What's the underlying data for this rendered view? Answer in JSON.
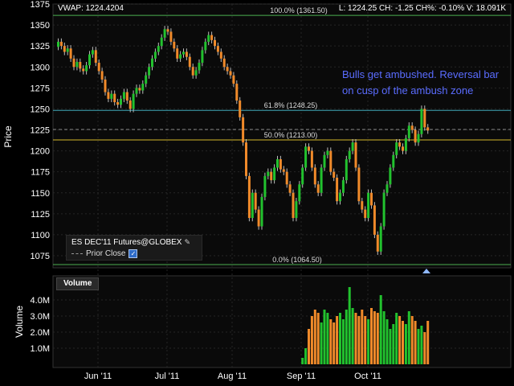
{
  "header": {
    "vwap": "VWAP: 1224.4204",
    "quote": "L: 1224.25  CH: -1.25  CH%: -0.10%  V: 18.091K"
  },
  "annotation": {
    "line1": "Bulls get ambushed. Reversal bar",
    "line2": "on cusp of the ambush zone",
    "color": "#5a6cff"
  },
  "legend": {
    "title": "ES DEC'11 Futures@GLOBEX",
    "prior_close": "Prior Close"
  },
  "volume_tab": "Volume",
  "colors": {
    "up": "#22c22e",
    "down": "#f08a2a",
    "fib_green": "#4caf50",
    "fib_teal": "#3fa8b8",
    "fib_yellow": "#d4b82a",
    "axis_text": "#ffffff",
    "grid": "#262626"
  },
  "chart_data": [
    {
      "type": "candlestick",
      "title": "ES DEC'11 Futures@GLOBEX",
      "ylabel": "Price",
      "ylim": [
        1062,
        1375
      ],
      "y_ticks": [
        1075,
        1100,
        1125,
        1150,
        1175,
        1200,
        1225,
        1250,
        1275,
        1300,
        1325,
        1350,
        1375
      ],
      "x_ticks": [
        "Jun '11",
        "Jul '11",
        "Aug '11",
        "Sep '11",
        "Oct '11"
      ],
      "fib_levels": [
        {
          "label": "100.0% (1361.50)",
          "value": 1361.5,
          "color": "#4caf50"
        },
        {
          "label": "61.8% (1248.25)",
          "value": 1248.25,
          "color": "#3fa8b8"
        },
        {
          "label": "50.0% (1213.00)",
          "value": 1213.0,
          "color": "#d4b82a"
        },
        {
          "label": "0.0% (1064.50)",
          "value": 1064.5,
          "color": "#4caf50"
        }
      ],
      "prior_close": 1225.5,
      "last": 1224.25,
      "closes": [
        1330,
        1325,
        1318,
        1322,
        1310,
        1300,
        1306,
        1298,
        1295,
        1302,
        1315,
        1320,
        1305,
        1295,
        1285,
        1270,
        1262,
        1268,
        1258,
        1255,
        1262,
        1270,
        1260,
        1250,
        1268,
        1275,
        1272,
        1280,
        1290,
        1300,
        1310,
        1318,
        1325,
        1335,
        1345,
        1342,
        1330,
        1322,
        1310,
        1315,
        1318,
        1312,
        1300,
        1290,
        1296,
        1305,
        1320,
        1330,
        1338,
        1332,
        1325,
        1318,
        1310,
        1300,
        1295,
        1290,
        1280,
        1260,
        1240,
        1210,
        1170,
        1120,
        1150,
        1130,
        1110,
        1145,
        1170,
        1175,
        1165,
        1180,
        1190,
        1178,
        1175,
        1160,
        1150,
        1120,
        1140,
        1160,
        1180,
        1205,
        1200,
        1180,
        1160,
        1150,
        1180,
        1195,
        1200,
        1175,
        1168,
        1140,
        1150,
        1165,
        1190,
        1200,
        1210,
        1180,
        1140,
        1130,
        1120,
        1150,
        1135,
        1100,
        1080,
        1110,
        1150,
        1160,
        1180,
        1195,
        1210,
        1205,
        1200,
        1215,
        1230,
        1225,
        1210,
        1220,
        1250,
        1228,
        1224.25
      ],
      "series": [
        {
          "name": "Volume",
          "ylabel": "Volume",
          "ylim": [
            0,
            4.8
          ],
          "y_ticks": [
            "1.0M",
            "2.0M",
            "3.0M",
            "4.0M"
          ],
          "values": [
            0.4,
            1.0,
            2.2,
            3.0,
            3.4,
            3.2,
            2.6,
            3.4,
            3.2,
            2.8,
            2.6,
            3.0,
            3.2,
            2.8,
            3.4,
            4.8,
            3.5,
            3.2,
            3.0,
            3.4,
            3.0,
            2.8,
            3.5,
            3.3,
            3.2,
            4.3,
            3.3,
            2.8,
            2.2,
            2.5,
            3.2,
            3.0,
            2.7,
            2.5,
            3.3,
            3.0,
            2.7,
            2.2,
            2.4,
            2.0,
            2.7
          ]
        }
      ]
    }
  ]
}
